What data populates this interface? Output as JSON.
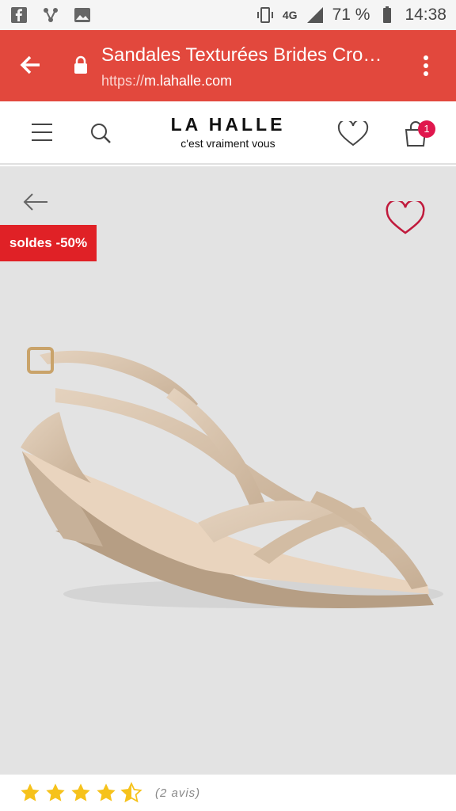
{
  "status_bar": {
    "network": "4G",
    "battery": "71 %",
    "time": "14:38"
  },
  "url_bar": {
    "title": "Sandales Texturées Brides Cro…",
    "scheme": "https://",
    "host": "m.lahalle.com"
  },
  "header": {
    "logo": "LA HALLE",
    "tagline": "c'est vraiment vous",
    "cart_count": "1"
  },
  "product": {
    "sale_badge": "soldes -50%",
    "rating": 4.5,
    "reviews": "(2 avis)"
  },
  "colors": {
    "chrome_red": "#e2483d",
    "sale_red": "#e02126",
    "accent_pink": "#e0174d",
    "star_yellow": "#f6c21b"
  }
}
